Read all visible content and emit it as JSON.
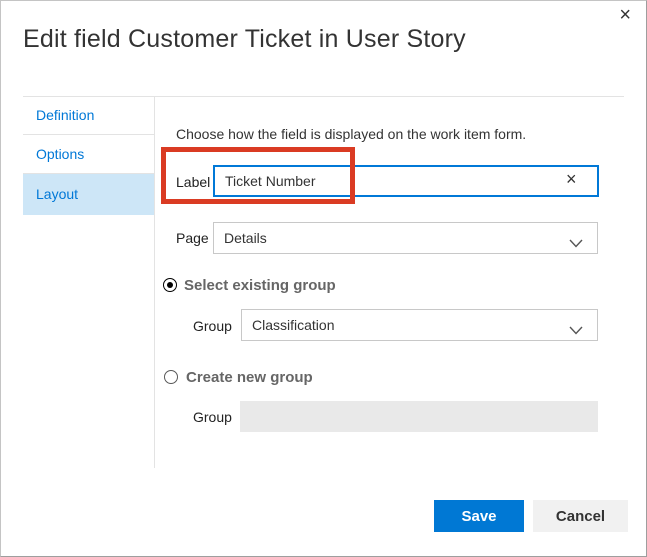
{
  "window": {
    "title": "Edit field Customer Ticket in User Story",
    "close_icon": "×"
  },
  "sidebar": {
    "tabs": [
      {
        "label": "Definition"
      },
      {
        "label": "Options"
      },
      {
        "label": "Layout"
      }
    ],
    "selected_tab": "Layout"
  },
  "form": {
    "intro": "Choose how the field is displayed on the work item form.",
    "label_field": {
      "label": "Label",
      "value": "Ticket Number",
      "clear_icon": "×"
    },
    "page_field": {
      "label": "Page",
      "value": "Details"
    },
    "existing_group": {
      "radio_label": "Select existing group",
      "checked": true,
      "group_field": {
        "label": "Group",
        "value": "Classification"
      }
    },
    "new_group": {
      "radio_label": "Create new group",
      "checked": false,
      "group_field": {
        "label": "Group",
        "value": ""
      }
    }
  },
  "footer": {
    "save_label": "Save",
    "cancel_label": "Cancel"
  },
  "colors": {
    "accent_blue": "#0078d7",
    "save_button_bg": "#0078d4",
    "tab_selected_bg": "#cde6f7",
    "annotation_red": "#da3b23",
    "disabled_input_bg": "#e9e9e9"
  }
}
